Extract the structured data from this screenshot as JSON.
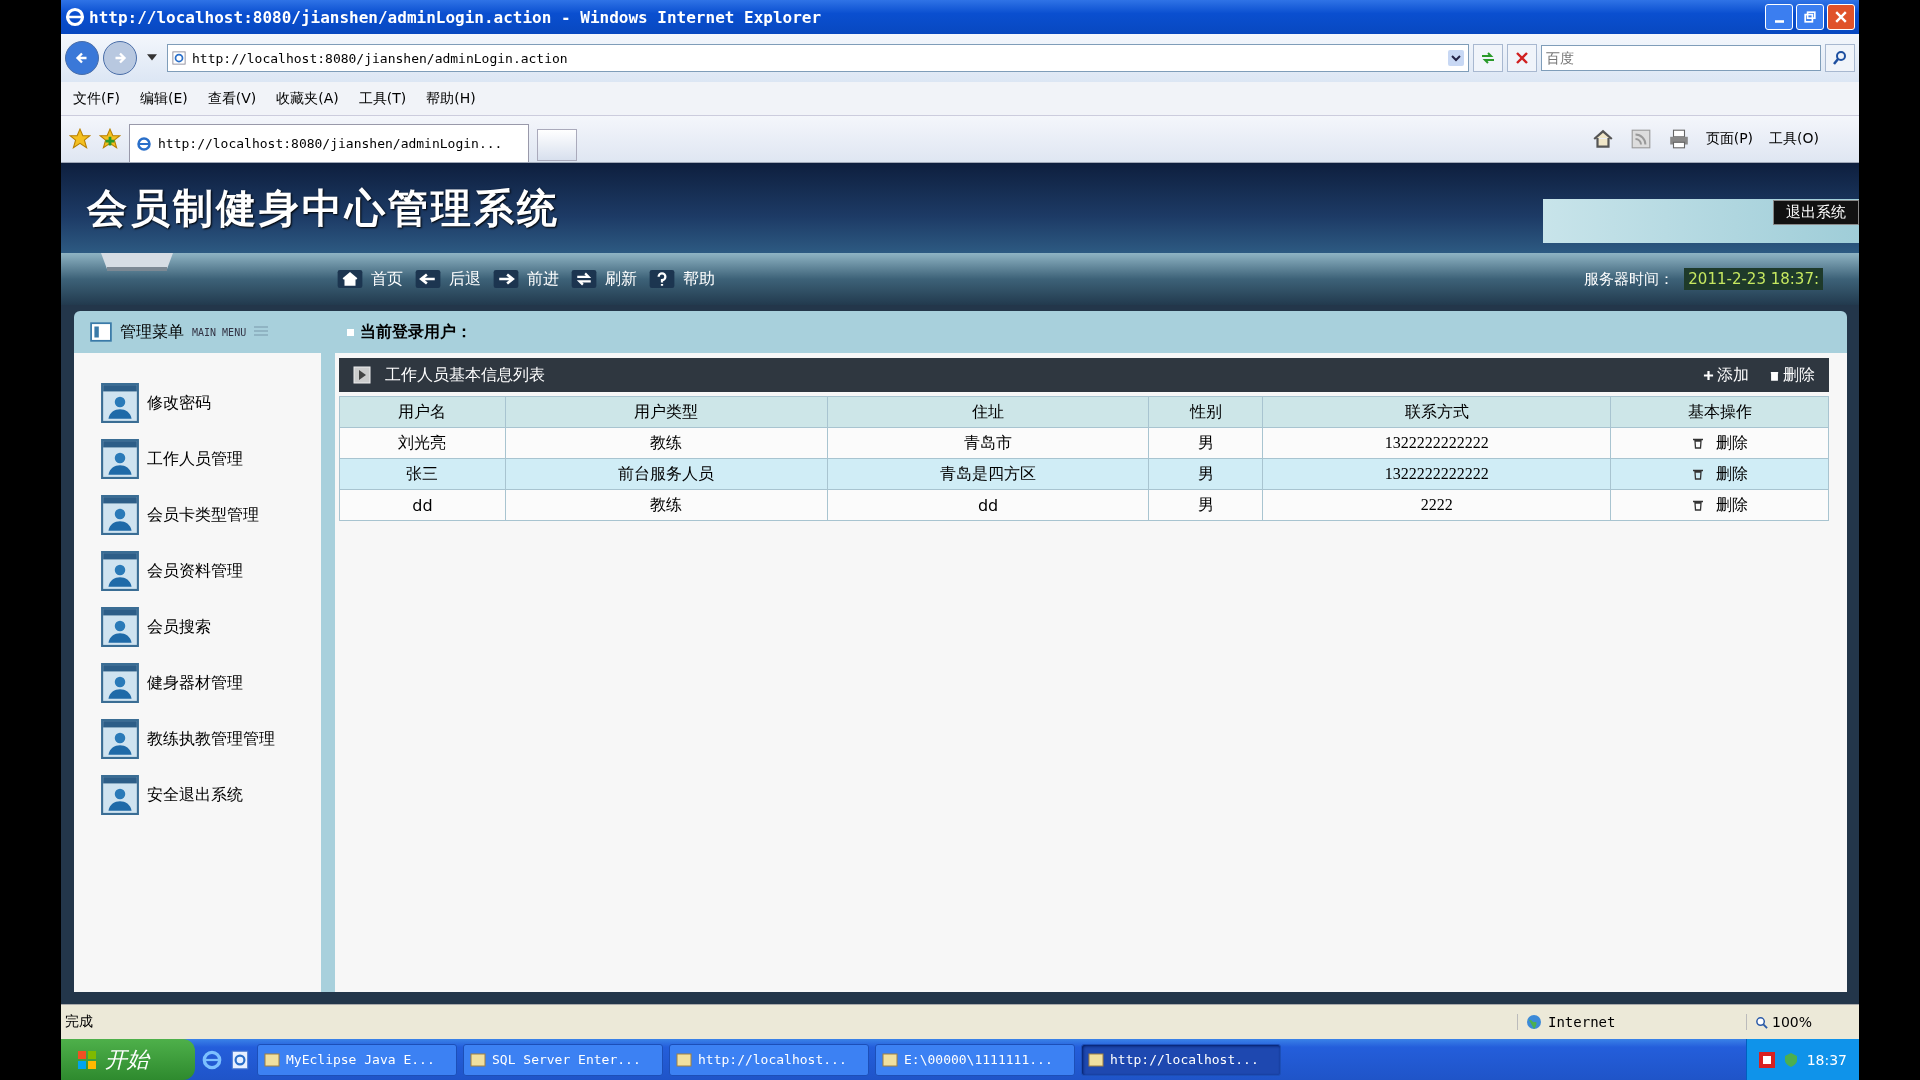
{
  "window": {
    "title": "http://localhost:8080/jianshen/adminLogin.action - Windows Internet Explorer"
  },
  "address": {
    "url": "http://localhost:8080/jianshen/adminLogin.action"
  },
  "search": {
    "placeholder": "百度"
  },
  "menu": [
    "文件(F)",
    "编辑(E)",
    "查看(V)",
    "收藏夹(A)",
    "工具(T)",
    "帮助(H)"
  ],
  "tab": {
    "label": "http://localhost:8080/jianshen/adminLogin..."
  },
  "command_bar": [
    "页面(P)",
    "工具(O)"
  ],
  "header": {
    "title": "会员制健身中心管理系统",
    "logout": "退出系统",
    "server_time_label": "服务器时间：",
    "server_time": "2011-2-23 18:37:"
  },
  "nav": [
    {
      "label": "首页",
      "kind": "home"
    },
    {
      "label": "后退",
      "kind": "back"
    },
    {
      "label": "前进",
      "kind": "forward"
    },
    {
      "label": "刷新",
      "kind": "refresh"
    },
    {
      "label": "帮助",
      "kind": "help"
    }
  ],
  "sidebar": {
    "title": "管理菜单",
    "subtitle": "MAIN MENU",
    "items": [
      "修改密码",
      "工作人员管理",
      "会员卡类型管理",
      "会员资料管理",
      "会员搜索",
      "健身器材管理",
      "教练执教管理管理",
      "安全退出系统"
    ]
  },
  "current_user": {
    "label": "当前登录用户："
  },
  "panel": {
    "title": "工作人员基本信息列表",
    "actions": [
      {
        "label": "添加",
        "kind": "add"
      },
      {
        "label": "删除",
        "kind": "delete"
      }
    ]
  },
  "table": {
    "columns": [
      "用户名",
      "用户类型",
      "住址",
      "性别",
      "联系方式",
      "基本操作"
    ],
    "rows": [
      {
        "cells": [
          "刘光亮",
          "教练",
          "青岛市",
          "男",
          "1322222222222"
        ],
        "action": "删除",
        "selected": false
      },
      {
        "cells": [
          "张三",
          "前台服务人员",
          "青岛是四方区",
          "男",
          "1322222222222"
        ],
        "action": "删除",
        "selected": true
      },
      {
        "cells": [
          "dd",
          "教练",
          "dd",
          "男",
          "2222"
        ],
        "action": "删除",
        "selected": false
      }
    ]
  },
  "status_bar": {
    "text": "完成",
    "zone": "Internet",
    "zoom": "100%"
  },
  "taskbar": {
    "start": "开始",
    "tasks": [
      {
        "label": "MyEclipse Java E...",
        "selected": false
      },
      {
        "label": "SQL Server Enter...",
        "selected": false
      },
      {
        "label": "http://localhost...",
        "selected": false
      },
      {
        "label": "E:\\00000\\1111111...",
        "selected": false
      },
      {
        "label": "http://localhost...",
        "selected": true
      }
    ],
    "clock": "18:37"
  }
}
